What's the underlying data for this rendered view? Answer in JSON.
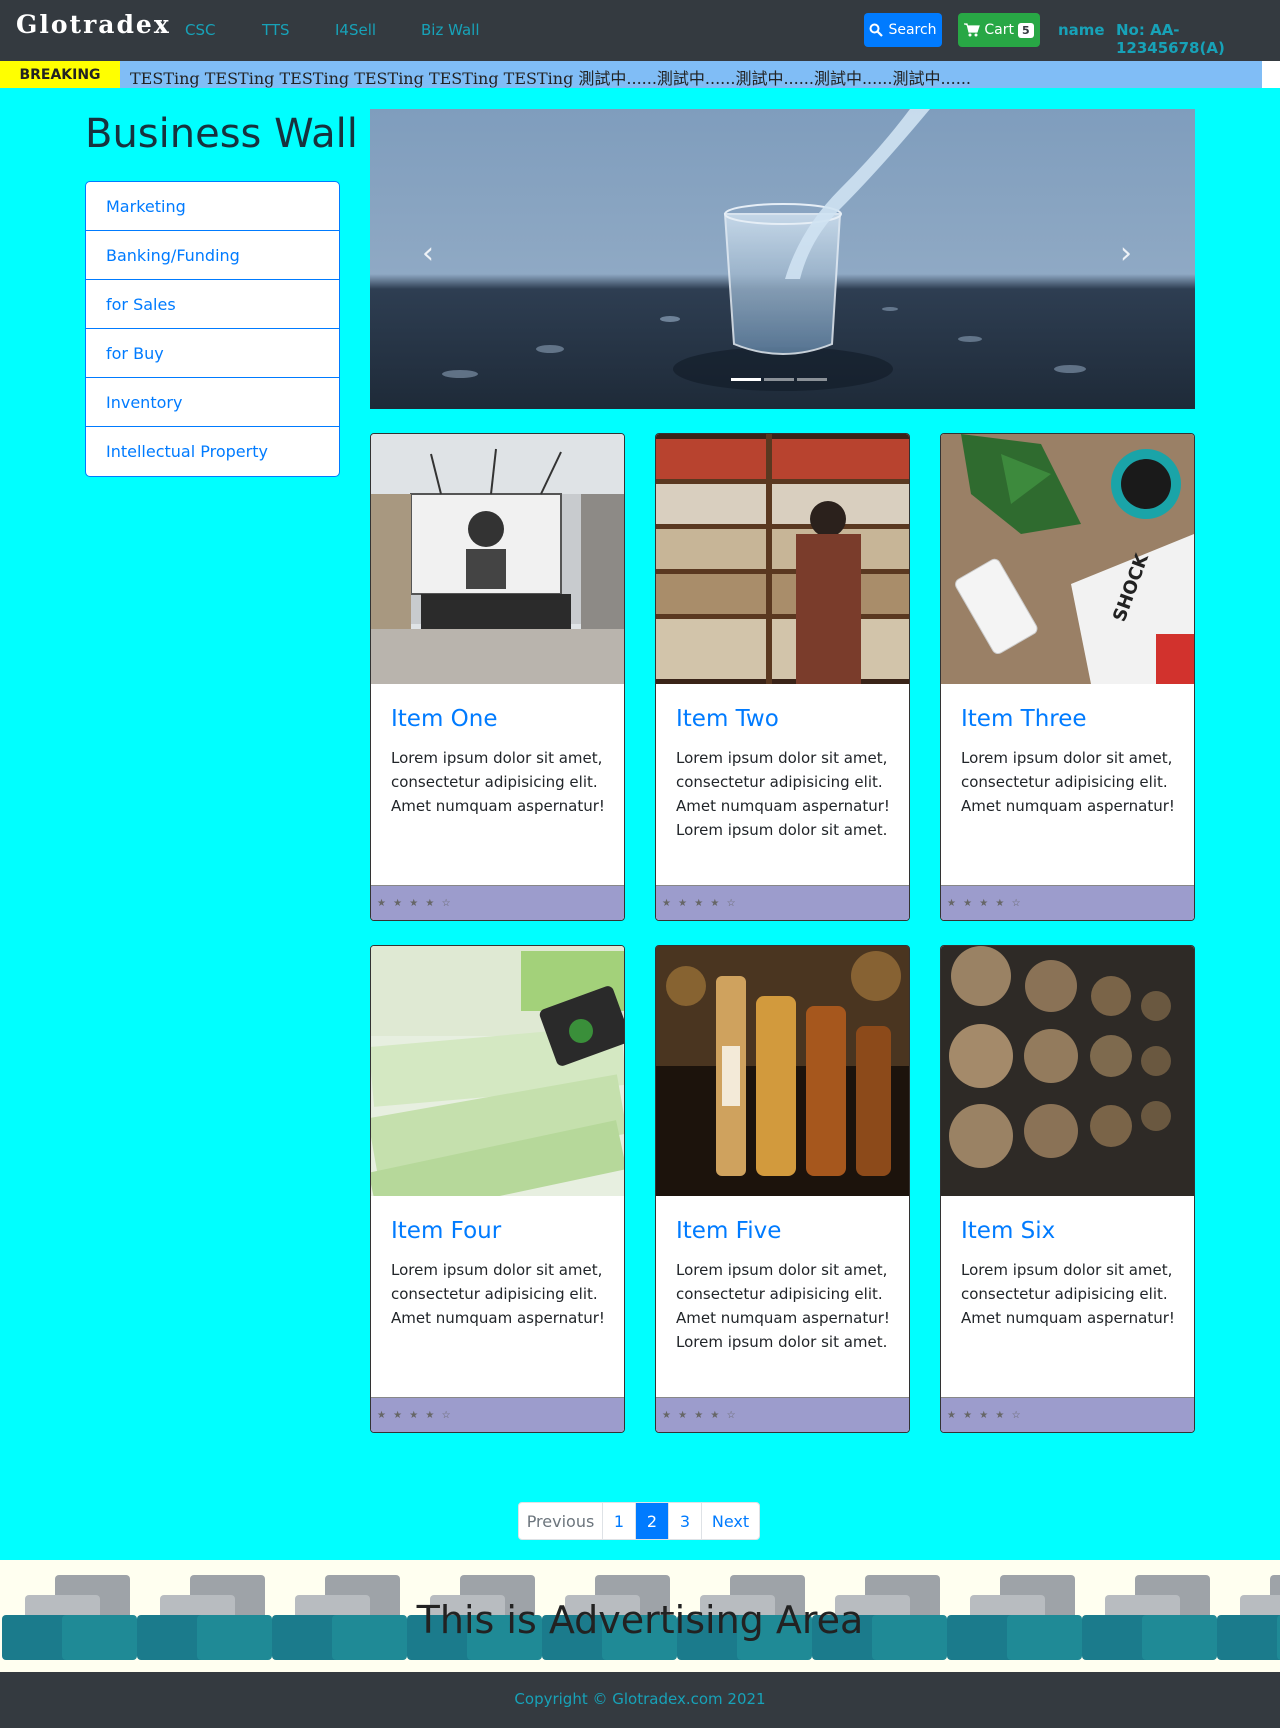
{
  "nav": {
    "brand": "Glotradex",
    "links": [
      "CSC",
      "TTS",
      "I4Sell",
      "Biz Wall"
    ],
    "search_label": "Search",
    "cart_label": "Cart",
    "cart_count": "5",
    "user": "name",
    "account_no": "No: AA-12345678(A)"
  },
  "breaking": {
    "label": "BREAKING",
    "text": "TESTing TESTing TESTing TESTing TESTing TESTing 測試中......測試中......測試中......測試中......測試中......"
  },
  "sidebar": {
    "title": "Business Wall",
    "items": [
      "Marketing",
      "Banking/Funding",
      "for Sales",
      "for Buy",
      "Inventory",
      "Intellectual Property"
    ]
  },
  "carousel": {
    "prev_icon": "chevron-left-icon",
    "next_icon": "chevron-right-icon",
    "slides": 3,
    "active_slide": 1
  },
  "cards": [
    {
      "title": "Item One",
      "text": "Lorem ipsum dolor sit amet, consectetur adipisicing elit. Amet numquam aspernatur!",
      "rating": "★ ★ ★ ★ ☆"
    },
    {
      "title": "Item Two",
      "text": "Lorem ipsum dolor sit amet, consectetur adipisicing elit. Amet numquam aspernatur! Lorem ipsum dolor sit amet.",
      "rating": "★ ★ ★ ★ ☆"
    },
    {
      "title": "Item Three",
      "text": "Lorem ipsum dolor sit amet, consectetur adipisicing elit. Amet numquam aspernatur!",
      "rating": "★ ★ ★ ★ ☆"
    },
    {
      "title": "Item Four",
      "text": "Lorem ipsum dolor sit amet, consectetur adipisicing elit. Amet numquam aspernatur!",
      "rating": "★ ★ ★ ★ ☆"
    },
    {
      "title": "Item Five",
      "text": "Lorem ipsum dolor sit amet, consectetur adipisicing elit. Amet numquam aspernatur! Lorem ipsum dolor sit amet.",
      "rating": "★ ★ ★ ★ ☆"
    },
    {
      "title": "Item Six",
      "text": "Lorem ipsum dolor sit amet, consectetur adipisicing elit. Amet numquam aspernatur!",
      "rating": "★ ★ ★ ★ ☆"
    }
  ],
  "pagination": {
    "previous": "Previous",
    "pages": [
      "1",
      "2",
      "3"
    ],
    "active_page": "2",
    "next": "Next"
  },
  "ad": {
    "text": "This is Advertising Area"
  },
  "footer": {
    "copyright": "Copyright © Glotradex.com 2021"
  },
  "colors": {
    "page_bg": "#00ffff",
    "navbar_bg": "#343a40",
    "link": "#17a2b8",
    "primary": "#007bff",
    "success": "#28a745",
    "breaking_label": "#ffff00",
    "card_footer": "#9c9ccc"
  }
}
